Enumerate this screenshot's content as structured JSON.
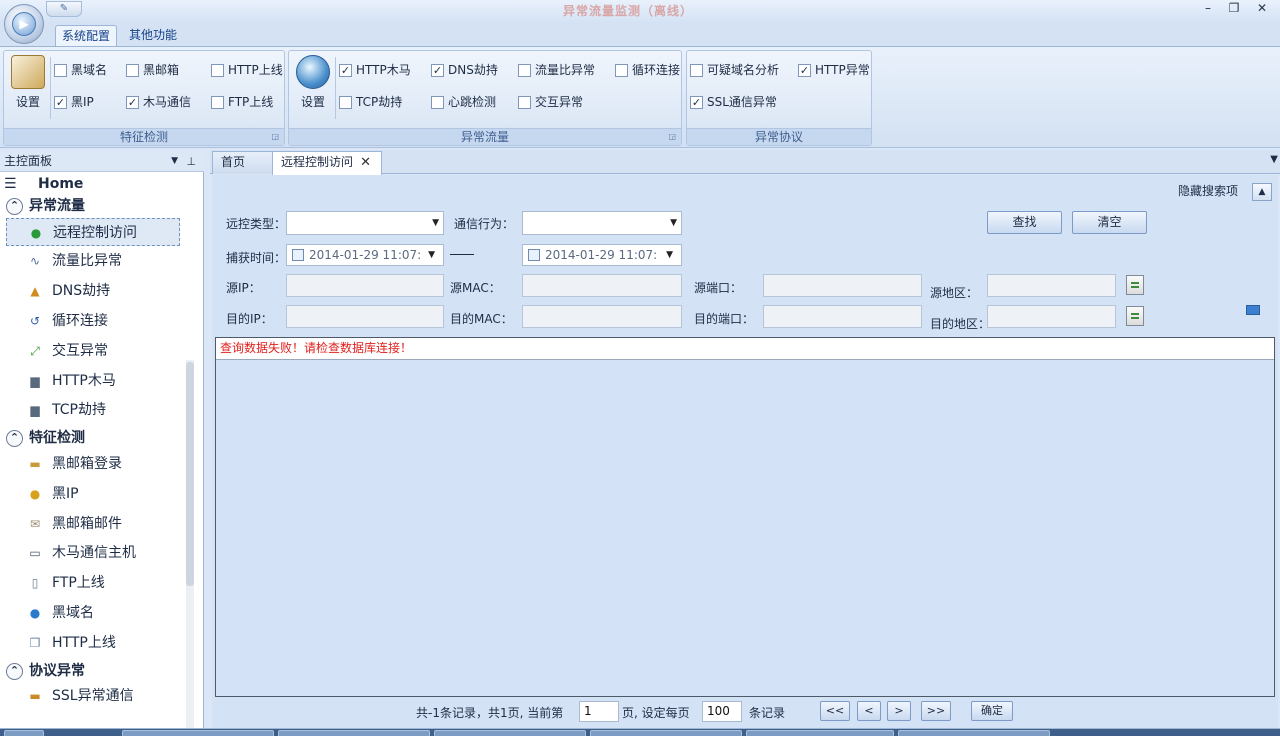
{
  "window": {
    "title": "异常流量监测（离线）",
    "min": "–",
    "restore": "❐",
    "close": "✕"
  },
  "ribbon_tabs": [
    "系统配置",
    "其他功能"
  ],
  "groups": {
    "feature": {
      "label": "特征检测",
      "button": "设置",
      "checks": [
        {
          "label": "黑域名",
          "checked": false
        },
        {
          "label": "黑邮箱",
          "checked": false
        },
        {
          "label": "HTTP上线",
          "checked": false
        },
        {
          "label": "黑IP",
          "checked": true
        },
        {
          "label": "木马通信",
          "checked": true
        },
        {
          "label": "FTP上线",
          "checked": false
        }
      ]
    },
    "traffic": {
      "label": "异常流量",
      "button": "设置",
      "checks": [
        {
          "label": "HTTP木马",
          "checked": true
        },
        {
          "label": "DNS劫持",
          "checked": true
        },
        {
          "label": "流量比异常",
          "checked": false
        },
        {
          "label": "循环连接",
          "checked": false
        },
        {
          "label": "TCP劫持",
          "checked": false
        },
        {
          "label": "心跳检测",
          "checked": false
        },
        {
          "label": "交互异常",
          "checked": false
        }
      ]
    },
    "protocol": {
      "label": "异常协议",
      "checks": [
        {
          "label": "可疑域名分析",
          "checked": false
        },
        {
          "label": "HTTP异常",
          "checked": true
        },
        {
          "label": "SSL通信异常",
          "checked": true
        }
      ]
    }
  },
  "left_panel": {
    "title": "主控面板",
    "home": "Home",
    "categories": [
      "异常流量",
      "特征检测",
      "协议异常"
    ],
    "traffic_items": [
      "远程控制访问",
      "流量比异常",
      "DNS劫持",
      "循环连接",
      "交互异常",
      "HTTP木马",
      "TCP劫持"
    ],
    "feature_items": [
      "黑邮箱登录",
      "黑IP",
      "黑邮箱邮件",
      "木马通信主机",
      "FTP上线",
      "黑域名",
      "HTTP上线"
    ],
    "protocol_items": [
      "SSL异常通信"
    ]
  },
  "doc_tabs": {
    "home": "首页",
    "active": "远程控制访问"
  },
  "search": {
    "hide_label": "隐藏搜索项",
    "remote_type_label": "远控类型：",
    "remote_type_value": "",
    "comm_label": "通信行为：",
    "comm_value": "",
    "find_button": "查找",
    "clear_button": "清空",
    "time_label": "捕获时间：",
    "time_from": "2014-01-29 11:07:",
    "time_to": "2014-01-29 11:07:",
    "src_ip_label": "源IP：",
    "src_mac_label": "源MAC：",
    "src_port_label": "源端口：",
    "src_region_label": "源地区：",
    "dst_ip_label": "目的IP：",
    "dst_mac_label": "目的MAC：",
    "dst_port_label": "目的端口：",
    "dst_region_label": "目的地区："
  },
  "result": {
    "error_message": "查询数据失败！请检查数据库连接！"
  },
  "pager": {
    "summary": "共-1条记录，共1页, 当前第",
    "current_page": "1",
    "per_page_label": "页, 设定每页",
    "per_page": "100",
    "records_label": "条记录",
    "first": "<<",
    "prev": "<",
    "next": ">",
    "last": ">>",
    "confirm": "确定"
  },
  "colors": {
    "error": "#e0201e",
    "ribbon": "#d5e2f4",
    "content_bg": "#d4e2f6"
  }
}
